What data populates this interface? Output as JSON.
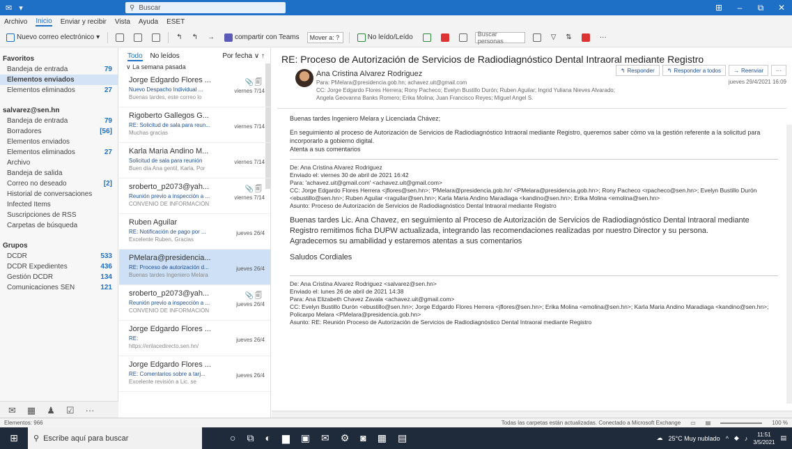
{
  "titlebar": {
    "search_placeholder": "Buscar",
    "window_controls": [
      "⊞",
      "–",
      "⧉",
      "✕"
    ]
  },
  "menu": [
    "Archivo",
    "Inicio",
    "Enviar y recibir",
    "Vista",
    "Ayuda",
    "ESET"
  ],
  "ribbon": {
    "new_email": "Nuevo correo electrónico",
    "share_teams": "compartir con Teams",
    "move_to": "Mover a: ?",
    "unread": "No leído/Leído",
    "search_people": "Buscar personas"
  },
  "folders": {
    "favorites_header": "Favoritos",
    "favorites": [
      {
        "name": "Bandeja de entrada",
        "count": "79"
      },
      {
        "name": "Elementos enviados",
        "count": "",
        "selected": true
      },
      {
        "name": "Elementos eliminados",
        "count": "27"
      }
    ],
    "account_header": "salvarez@sen.hn",
    "account": [
      {
        "name": "Bandeja de entrada",
        "count": "79"
      },
      {
        "name": "Borradores",
        "count": "[56]"
      },
      {
        "name": "Elementos enviados",
        "count": ""
      },
      {
        "name": "Elementos eliminados",
        "count": "27"
      },
      {
        "name": "Archivo",
        "count": ""
      },
      {
        "name": "Bandeja de salida",
        "count": ""
      },
      {
        "name": "Correo no deseado",
        "count": "[2]"
      },
      {
        "name": "Historial de conversaciones",
        "count": ""
      },
      {
        "name": "Infected Items",
        "count": ""
      },
      {
        "name": "Suscripciones de RSS",
        "count": ""
      },
      {
        "name": "Carpetas de búsqueda",
        "count": ""
      }
    ],
    "groups_header": "Grupos",
    "groups": [
      {
        "name": "DCDR",
        "count": "533"
      },
      {
        "name": "DCDR Expedientes",
        "count": "436"
      },
      {
        "name": "Gestión DCDR",
        "count": "134"
      },
      {
        "name": "Comunicaciones SEN",
        "count": "121"
      }
    ]
  },
  "msglist": {
    "tab_all": "Todo",
    "tab_unread": "No leídos",
    "sort": "Por fecha ∨ ↑",
    "group": "La semana pasada",
    "messages": [
      {
        "from": "Jorge Edgardo Flores ...",
        "subject": "Nuevo Despacho Individual ...",
        "preview": "Buenas tardes, este correo lo",
        "date": "viernes 7/14",
        "icons": "📎🗐"
      },
      {
        "from": "Rigoberto Gallegos G...",
        "subject": "RE: Solicitud de sala para reun...",
        "preview": "Muchas gracias",
        "date": "viernes 7/14",
        "icons": ""
      },
      {
        "from": "Karla Maria Andino M...",
        "subject": "Solicitud de sala para reunión",
        "preview": "Buen día Ana gentil, Karla, Por",
        "date": "viernes 7/14",
        "icons": ""
      },
      {
        "from": "sroberto_p2073@yah...",
        "subject": "Reunión previo a inspección a ...",
        "preview": "CONVENIO DE INFORMACIÓN",
        "date": "viernes 7/14",
        "icons": "📎🗐"
      },
      {
        "from": "Ruben Aguilar",
        "subject": "RE: Notificación de pago por ...",
        "preview": "Excelente Ruben, Gracias",
        "date": "jueves 26/4",
        "icons": ""
      },
      {
        "from": "PMelara@presidencia...",
        "subject": "RE: Proceso de autorización d...",
        "preview": "Buenas tardes Ingeniero Melara",
        "date": "jueves 26/4",
        "icons": "",
        "selected": true
      },
      {
        "from": "sroberto_p2073@yah...",
        "subject": "Reunión previo a inspección a ...",
        "preview": "CONVENIO DE INFORMACIÓN",
        "date": "jueves 26/4",
        "icons": "📎🗐"
      },
      {
        "from": "Jorge Edgardo Flores ...",
        "subject": "RE:",
        "preview": "https://enlacedirecto.sen.hn/",
        "date": "jueves 26/4",
        "icons": ""
      },
      {
        "from": "Jorge Edgardo Flores ...",
        "subject": "RE: Comentarios sobre a tarj...",
        "preview": "Excelente revisión a Lic. se",
        "date": "jueves 26/4",
        "icons": ""
      }
    ]
  },
  "reading": {
    "subject": "RE: Proceso de Autorización de Servicios de Radiodiagnóstico Dental Intraoral mediante Registro",
    "sender": "Ana Cristina Alvarez Rodriguez",
    "to_line": "Para: PMelara@presidencia.gob.hn; achavez.uit@gmail.com",
    "cc_line": "CC: Jorge Edgardo Flores Herrera; Rony Pacheco; Evelyn Bustillo Durón; Ruben Aguilar; Ingrid Yuliana Nieves Alvarado;",
    "cc_line2": "Angela Geovanna Banks Romero; Erika Molina; Juan Francisco Reyes; Miguel Angel S.",
    "date": "jueves 29/4/2021 16:09",
    "actions": [
      "Responder",
      "Responder a todos",
      "Reenviar",
      "···"
    ],
    "greeting": "Buenas tardes Ingeniero Melara y Licenciada Chávez;",
    "body1": "En seguimiento al proceso de Autorización de Servicios de Radiodiagnóstico Intraoral mediante Registro, queremos saber cómo va la gestión referente a la solicitud para incorporarlo a gobierno digital.",
    "body2": "Atenta a sus comentarios",
    "fwd1": {
      "from": "De: Ana Cristina Alvarez Rodriguez",
      "sent": "Enviado el: viernes 30 de abril de 2021 16:42",
      "to": "Para: 'achavez.uit@gmail.com' <achavez.uit@gmail.com>",
      "cc": "CC: Jorge Edgardo Flores Herrera <jflores@sen.hn>; 'PMelara@presidencia.gob.hn' <PMelara@presidencia.gob.hn>; Rony Pacheco <rpacheco@sen.hn>; Evelyn Bustillo Durón <ebustillo@sen.hn>; Ruben Aguilar <raguilar@sen.hn>; Karla Maria Andino Maradiaga <kandino@sen.hn>; Erika Molina <emolina@sen.hn>",
      "subject": "Asunto: Proceso de Autorización de Servicios de Radiodiagnóstico Dental Intraoral mediante Registro"
    },
    "msg1": "Buenas tardes Lic. Ana Chavez, en seguimiento al Proceso de Autorización de Servicios de Radiodiagnóstico Dental Intraoral mediante Registro remitimos ficha DUPW actualizada, integrando las recomendaciones realizadas por nuestro Director y su persona.",
    "msg2": "Agradecemos su amabilidad y estaremos atentas a sus comentarios",
    "sign": "Saludos Cordiales",
    "fwd2": {
      "from": "De: Ana Cristina Alvarez Rodriguez <salvarez@sen.hn>",
      "sent": "Enviado el: lunes 26 de abril de 2021 14:38",
      "to": "Para: Ana Elizabeth Chavez Zavala <achavez.uit@gmail.com>",
      "cc": "CC: Evelyn Bustillo Durón <ebustillo@sen.hn>; Jorge Edgardo Flores Herrera <jflores@sen.hn>; Erika Molina <emolina@sen.hn>; Karla Maria Andino Maradiaga <kandino@sen.hn>; Policarpo Melara <PMelara@presidencia.gob.hn>",
      "subject": "Asunto: RE: Reunión Proceso de Autorización de Servicios de Radiodiagnóstico Dental Intraoral mediante Registro"
    }
  },
  "statusbar": {
    "left": "Elementos: 966",
    "middle": "Todas las carpetas están actualizadas.   Conectado a Microsoft Exchange",
    "zoom": "100 %"
  },
  "taskbar": {
    "search": "Escribe aquí para buscar",
    "weather": "25°C Muy nublado",
    "time": "11:51",
    "date": "3/5/2021"
  }
}
